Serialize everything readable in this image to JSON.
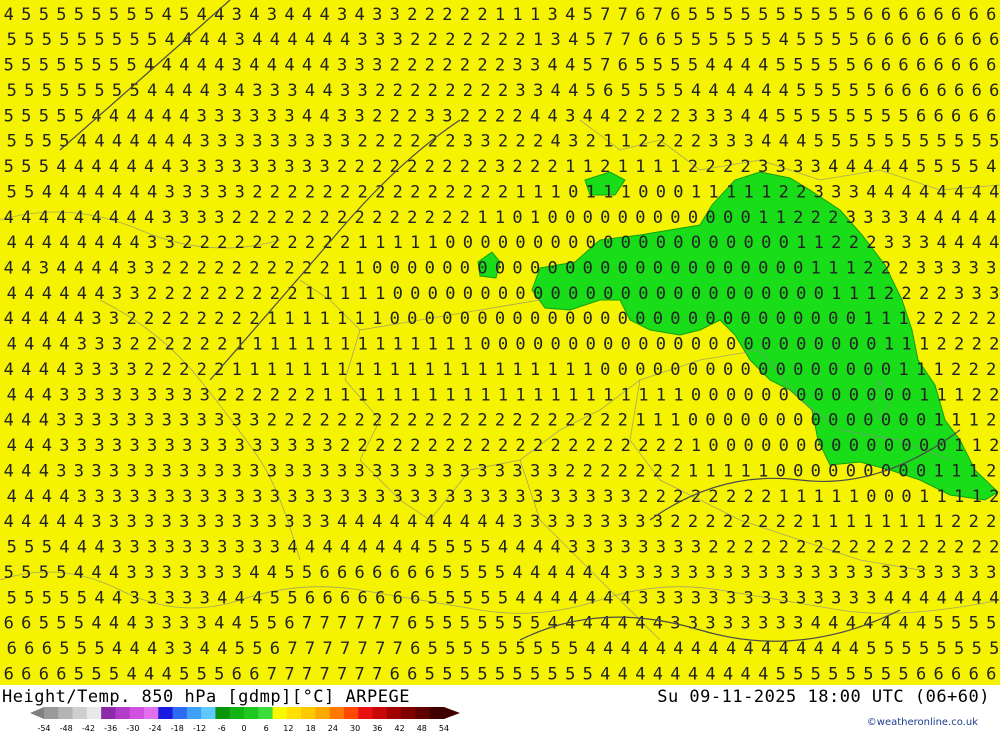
{
  "title": {
    "left": "Height/Temp. 850 hPa [gdmp][°C] ARPEGE",
    "right": "Su 09-11-2025 18:00 UTC (06+60)"
  },
  "credit": "©weatheronline.co.uk",
  "colors": {
    "background_yellow": "#f6f300",
    "region_green": "#19dd19",
    "border_gray": "#8a8a8a",
    "digit": "#222222"
  },
  "legend": {
    "tick_labels": [
      "-54",
      "-48",
      "-42",
      "-36",
      "-30",
      "-24",
      "-18",
      "-12",
      "-6",
      "0",
      "6",
      "12",
      "18",
      "24",
      "30",
      "36",
      "42",
      "48",
      "54"
    ],
    "swatches": [
      "#9a9a9a",
      "#b4b4b4",
      "#cfcfcf",
      "#e8e8e8",
      "#8c2aa8",
      "#b03cc8",
      "#d050e0",
      "#e070f0",
      "#1a1ae0",
      "#2d6cf0",
      "#3fa0f8",
      "#5fc8ff",
      "#0a960a",
      "#14b414",
      "#1ec81e",
      "#3cdc3c",
      "#f8f800",
      "#ffe000",
      "#ffc800",
      "#ffa800",
      "#ff7800",
      "#ff4800",
      "#e81010",
      "#c80808",
      "#a00000",
      "#800000",
      "#600000",
      "#400000"
    ]
  },
  "map": {
    "digit_field": [
      "455555555454434344434332222211134577676555555555566666666",
      "555555555444434444443332222222134577665555554555566666666",
      "555555554444434444433322222223344576555544445555566666666",
      "555555554444343334433222222223344565555444444555556666666",
      "555554444443333334433222332222443442222333445555555566666",
      "555544444443333333332222223322243211222233344455555555555",
      "555444444433333333322222222232221121111222233334444455554",
      "554444444333332222222222222221110111000111112233344444444",
      "444444444333322222222222222110100000000000011222333344444",
      "444444443322222222221111100000000000000000000112223334444",
      "443444433222222222211000000000000000000000000011122233333",
      "444444332222222221111100000000000000000000000001112222333",
      "444443322222222111111100000000000000000000000000011122222",
      "444433322222211111111111111000000000000000000000001112222",
      "444433332222211111111111111111111100000000000000000111222",
      "444333333333222222111111111111111111111000000000000011122",
      "444333333333333222222222222222222222111000000000000001112",
      "444333333333333333322222222222222222222100000000000000112",
      "444333333333333333333333333333332222222111110000000001112",
      "444433333333333333333333333333333333222222221111100011112",
      "444443333333333333344444444443333333332222222211111111222",
      "555444333333333344444444555544443333333322222222222222222",
      "555544433333334455666666655554444443333333333333333333333",
      "555554433333444556666666555554444444333333333333334444444",
      "665554443333445567777776555555544444443333333344444445555",
      "666555444334455677777776555555555444444444444444455555555",
      "666655544455566777777766555555555544444444445555555566666"
    ],
    "plotted_values_caption": "gdmp contour labels"
  }
}
